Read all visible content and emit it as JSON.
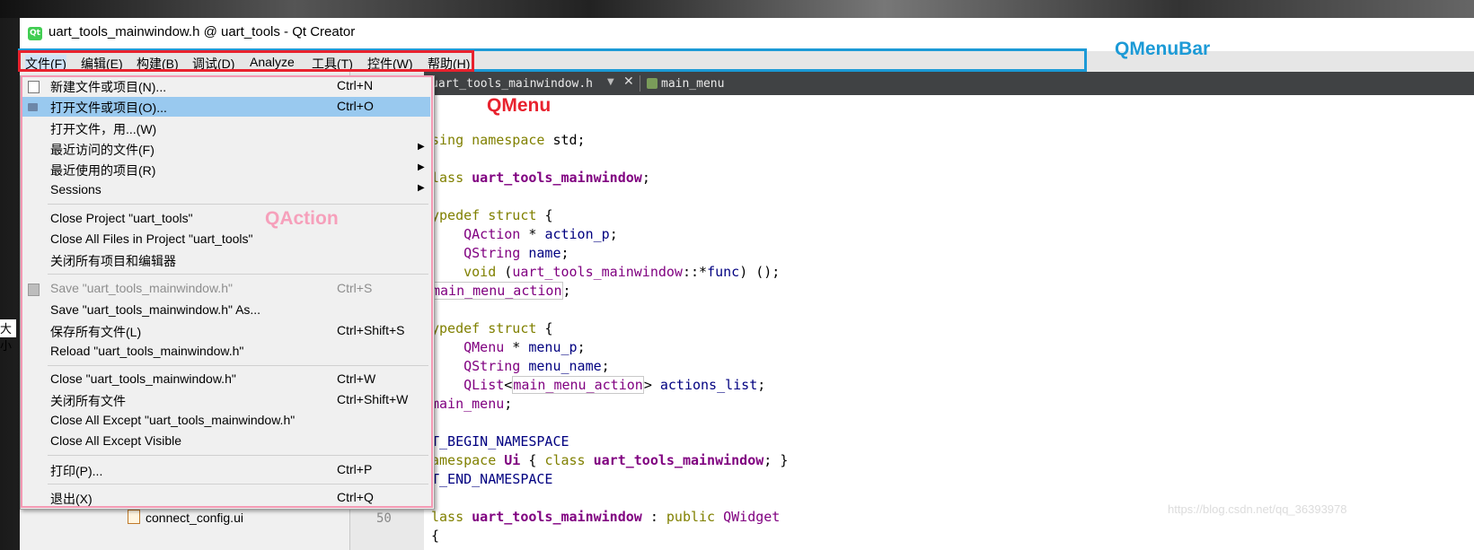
{
  "window": {
    "title": "uart_tools_mainwindow.h @ uart_tools - Qt Creator",
    "icon_text": "Qt"
  },
  "menubar": {
    "items": [
      "文件(F)",
      "编辑(E)",
      "构建(B)",
      "调试(D)",
      "Analyze",
      "工具(T)",
      "控件(W)",
      "帮助(H)"
    ]
  },
  "file_menu": {
    "items": [
      {
        "label": "新建文件或项目(N)...",
        "shortcut": "Ctrl+N",
        "icon": "new-file-icon"
      },
      {
        "label": "打开文件或项目(O)...",
        "shortcut": "Ctrl+O",
        "icon": "open-folder-icon",
        "highlighted": true
      },
      {
        "label": "打开文件，用...(W)",
        "shortcut": ""
      },
      {
        "label": "最近访问的文件(F)",
        "shortcut": "",
        "submenu": true
      },
      {
        "label": "最近使用的项目(R)",
        "shortcut": "",
        "submenu": true
      },
      {
        "label": "Sessions",
        "shortcut": "",
        "submenu": true
      },
      {
        "label": "Close Project \"uart_tools\"",
        "shortcut": ""
      },
      {
        "label": "Close All Files in Project \"uart_tools\"",
        "shortcut": ""
      },
      {
        "label": "关闭所有项目和编辑器",
        "shortcut": ""
      },
      {
        "label": "Save \"uart_tools_mainwindow.h\"",
        "shortcut": "Ctrl+S",
        "disabled": true,
        "icon": "save-icon"
      },
      {
        "label": "Save \"uart_tools_mainwindow.h\" As...",
        "shortcut": ""
      },
      {
        "label": "保存所有文件(L)",
        "shortcut": "Ctrl+Shift+S"
      },
      {
        "label": "Reload \"uart_tools_mainwindow.h\"",
        "shortcut": ""
      },
      {
        "label": "Close \"uart_tools_mainwindow.h\"",
        "shortcut": "Ctrl+W"
      },
      {
        "label": "关闭所有文件",
        "shortcut": "Ctrl+Shift+W"
      },
      {
        "label": "Close All Except \"uart_tools_mainwindow.h\"",
        "shortcut": ""
      },
      {
        "label": "Close All Except Visible",
        "shortcut": ""
      },
      {
        "label": "打印(P)...",
        "shortcut": "Ctrl+P"
      },
      {
        "label": "退出(X)",
        "shortcut": "Ctrl+Q"
      }
    ]
  },
  "editor": {
    "tab_file": "uart_tools_mainwindow.h",
    "tab_symbol": "main_menu",
    "line_number_visible": "50",
    "project_file": "connect_config.ui",
    "code_lines": [
      "sing namespace std;",
      "",
      "lass uart_tools_mainwindow;",
      "",
      "ypedef struct {",
      "    QAction * action_p;",
      "    QString name;",
      "    void (uart_tools_mainwindow::*func) ();",
      "main_menu_action;",
      "",
      "ypedef struct {",
      "    QMenu * menu_p;",
      "    QString menu_name;",
      "    QList<main_menu_action> actions_list;",
      "main_menu;",
      "",
      "T_BEGIN_NAMESPACE",
      "amespace Ui { class uart_tools_mainwindow; }",
      "T_END_NAMESPACE",
      "",
      "lass uart_tools_mainwindow : public QWidget",
      "{"
    ]
  },
  "annotations": {
    "qmenubar": "QMenuBar",
    "qmenu": "QMenu",
    "qaction": "QAction"
  },
  "side_text": "大小",
  "watermark": "https://blog.csdn.net/qq_36393978",
  "colors": {
    "menubar_box": "#1c9ad6",
    "menu_items_box": "#e8222e",
    "qmenu_box": "#f49ab4",
    "highlight": "#99c9ef"
  }
}
